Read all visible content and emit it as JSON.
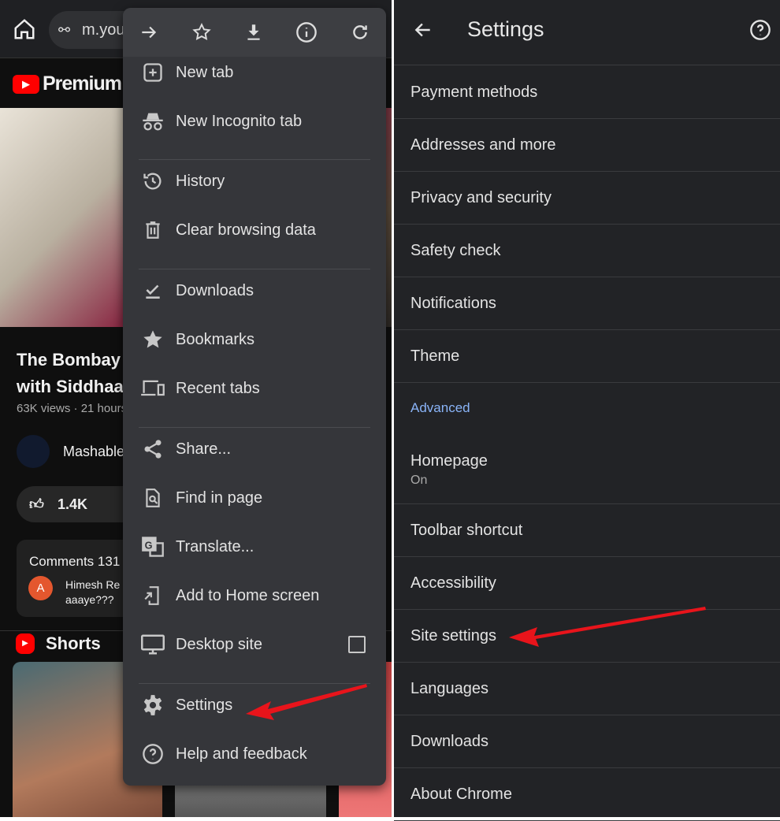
{
  "browser": {
    "url": "m.you"
  },
  "youtube": {
    "brand": "Premium",
    "video_title_1": "The Bombay",
    "video_title_2": "with Siddhaa",
    "meta": "63K views · 21 hours",
    "channel": "Mashable",
    "likes": "1.4K",
    "comments_label": "Comments 131",
    "comment_avatar": "A",
    "comment_author": "Himesh Re",
    "comment_text": "aaaye???",
    "shorts_label": "Shorts"
  },
  "menu": {
    "toolbar": [
      "forward-icon",
      "bookmark-star-icon",
      "download-icon",
      "info-icon",
      "refresh-icon"
    ],
    "items": [
      {
        "label": "New tab",
        "icon": "new-tab-icon"
      },
      {
        "label": "New Incognito tab",
        "icon": "incognito-icon"
      },
      {
        "label": "History",
        "icon": "history-icon"
      },
      {
        "label": "Clear browsing data",
        "icon": "trash-icon"
      },
      {
        "label": "Downloads",
        "icon": "downloads-icon"
      },
      {
        "label": "Bookmarks",
        "icon": "star-icon"
      },
      {
        "label": "Recent tabs",
        "icon": "devices-icon"
      },
      {
        "label": "Share...",
        "icon": "share-icon"
      },
      {
        "label": "Find in page",
        "icon": "find-icon"
      },
      {
        "label": "Translate...",
        "icon": "translate-icon"
      },
      {
        "label": "Add to Home screen",
        "icon": "add-home-icon"
      },
      {
        "label": "Desktop site",
        "icon": "desktop-icon",
        "checked": false
      },
      {
        "label": "Settings",
        "icon": "gear-icon"
      },
      {
        "label": "Help and feedback",
        "icon": "help-icon"
      }
    ]
  },
  "settings": {
    "title": "Settings",
    "section_advanced": "Advanced",
    "items": [
      "Payment methods",
      "Addresses and more",
      "Privacy and security",
      "Safety check",
      "Notifications",
      "Theme"
    ],
    "homepage": {
      "label": "Homepage",
      "value": "On"
    },
    "advanced_items": [
      "Toolbar shortcut",
      "Accessibility",
      "Site settings",
      "Languages",
      "Downloads",
      "About Chrome"
    ]
  },
  "colors": {
    "accent": "#8ab4f8",
    "arrow": "#e8141b",
    "yt_red": "#ff0000"
  }
}
